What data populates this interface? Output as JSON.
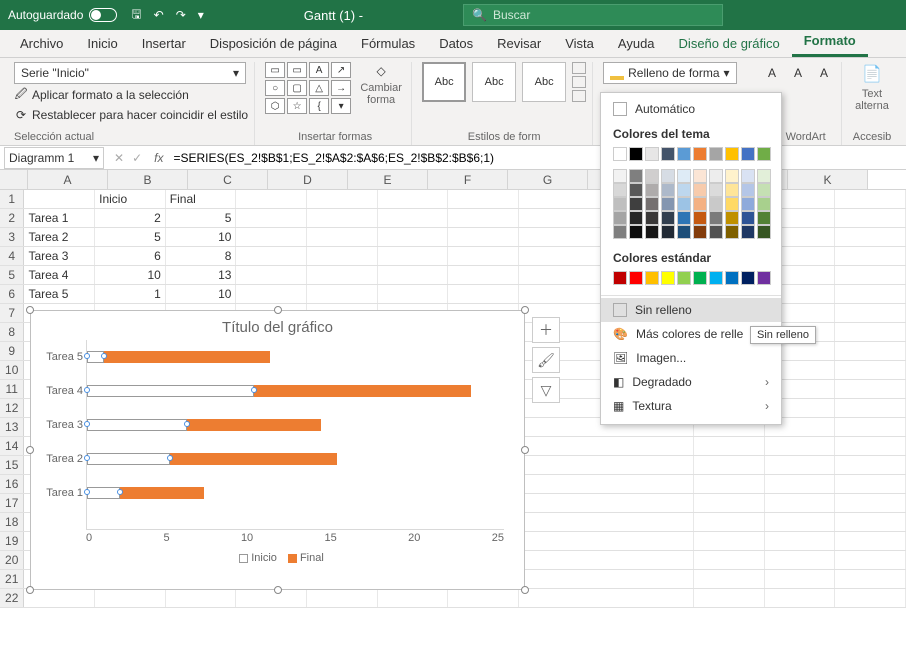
{
  "titlebar": {
    "autoguardado": "Autoguardado",
    "doc_title": "Gantt (1) -",
    "search_placeholder": "Buscar"
  },
  "tabs": [
    "Archivo",
    "Inicio",
    "Insertar",
    "Disposición de página",
    "Fórmulas",
    "Datos",
    "Revisar",
    "Vista",
    "Ayuda",
    "Diseño de gráfico",
    "Formato"
  ],
  "ribbon": {
    "selector_value": "Serie \"Inicio\"",
    "format_selection": "Aplicar formato a la selección",
    "reset_match": "Restablecer para hacer coincidir el estilo",
    "group_selection": "Selección actual",
    "change_shape": "Cambiar forma",
    "group_shapes": "Insertar formas",
    "abc": "Abc",
    "group_styles": "Estilos de form",
    "fill_label": "Relleno de forma",
    "group_wordart": "de WordArt",
    "text_label": "Text alterna",
    "group_access": "Accesib"
  },
  "fill_popup": {
    "automatic": "Automático",
    "theme_label": "Colores del tema",
    "theme_row1": [
      "#ffffff",
      "#000000",
      "#e7e6e6",
      "#44546a",
      "#5b9bd5",
      "#ed7d31",
      "#a5a5a5",
      "#ffc000",
      "#4472c4",
      "#70ad47"
    ],
    "theme_shades": [
      [
        "#f2f2f2",
        "#7f7f7f",
        "#d0cece",
        "#d6dce4",
        "#deebf6",
        "#fbe5d5",
        "#ededed",
        "#fff2cc",
        "#d9e2f3",
        "#e2efd9"
      ],
      [
        "#d8d8d8",
        "#595959",
        "#aeabab",
        "#adb9ca",
        "#bdd7ee",
        "#f7cbac",
        "#dbdbdb",
        "#fee599",
        "#b4c6e7",
        "#c5e0b3"
      ],
      [
        "#bfbfbf",
        "#3f3f3f",
        "#757070",
        "#8496b0",
        "#9cc3e5",
        "#f4b183",
        "#c9c9c9",
        "#ffd965",
        "#8eaadb",
        "#a8d08d"
      ],
      [
        "#a5a5a5",
        "#262626",
        "#3a3838",
        "#323f4f",
        "#2e75b5",
        "#c55a11",
        "#7b7b7b",
        "#bf9000",
        "#2f5496",
        "#538135"
      ],
      [
        "#7f7f7f",
        "#0c0c0c",
        "#171616",
        "#222a35",
        "#1e4e79",
        "#833c0b",
        "#525252",
        "#7f6000",
        "#1f3864",
        "#375623"
      ]
    ],
    "standard_label": "Colores estándar",
    "standard": [
      "#c00000",
      "#ff0000",
      "#ffc000",
      "#ffff00",
      "#92d050",
      "#00b050",
      "#00b0f0",
      "#0070c0",
      "#002060",
      "#7030a0"
    ],
    "no_fill": "Sin relleno",
    "more_colors": "Más colores de relle",
    "picture": "Imagen...",
    "gradient": "Degradado",
    "texture": "Textura",
    "tooltip": "Sin relleno"
  },
  "formula_bar": {
    "name": "Diagramm 1",
    "formula": "=SERIES(ES_2!$B$1;ES_2!$A$2:$A$6;ES_2!$B$2:$B$6;1)"
  },
  "columns": [
    "A",
    "B",
    "C",
    "D",
    "E",
    "F",
    "G",
    "",
    "",
    "",
    "K"
  ],
  "table": {
    "headers": {
      "b": "Inicio",
      "c": "Final"
    },
    "rows": [
      {
        "a": "Tarea 1",
        "b": 2,
        "c": 5
      },
      {
        "a": "Tarea 2",
        "b": 5,
        "c": 10
      },
      {
        "a": "Tarea 3",
        "b": 6,
        "c": 8
      },
      {
        "a": "Tarea 4",
        "b": 10,
        "c": 13
      },
      {
        "a": "Tarea 5",
        "b": 1,
        "c": 10
      }
    ]
  },
  "chart_data": {
    "type": "bar",
    "title": "Título del gráfico",
    "categories": [
      "Tarea 5",
      "Tarea 4",
      "Tarea 3",
      "Tarea 2",
      "Tarea 1"
    ],
    "series": [
      {
        "name": "Inicio",
        "values": [
          1,
          10,
          6,
          5,
          2
        ],
        "color": "#ffffff"
      },
      {
        "name": "Final",
        "values": [
          10,
          13,
          8,
          10,
          5
        ],
        "color": "#ed7d31"
      }
    ],
    "xlabel": "",
    "ylabel": "",
    "xlim": [
      0,
      25
    ],
    "xticks": [
      0,
      5,
      10,
      15,
      20,
      25
    ],
    "legend": [
      "Inicio",
      "Final"
    ]
  }
}
